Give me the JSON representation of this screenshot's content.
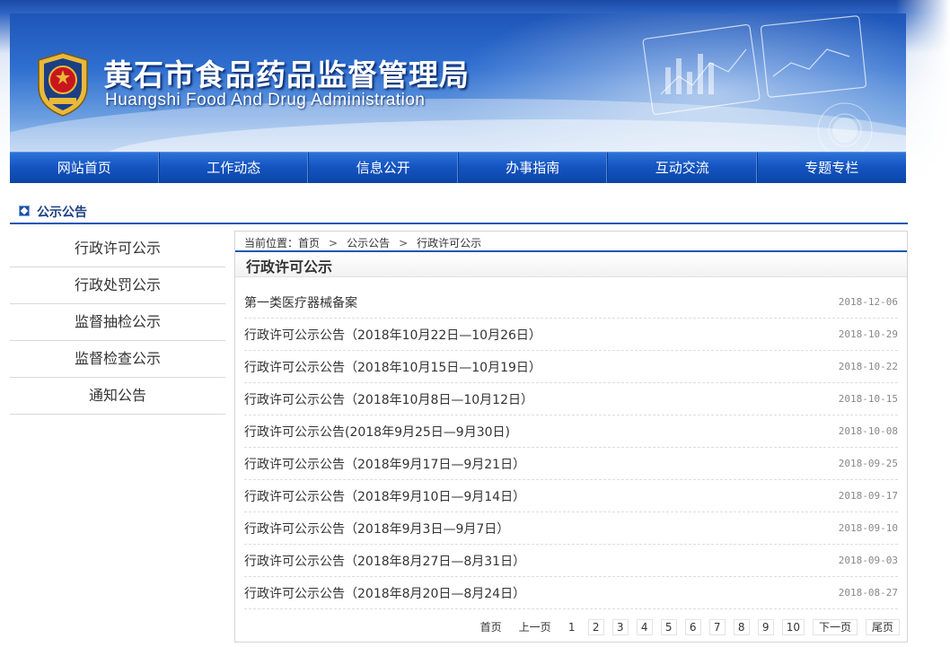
{
  "header": {
    "title": "黄石市食品药品监督管理局",
    "subtitle": "Huangshi Food And Drug Administration"
  },
  "nav": {
    "items": [
      "网站首页",
      "工作动态",
      "信息公开",
      "办事指南",
      "互动交流",
      "专题专栏"
    ]
  },
  "section": {
    "title": "公示公告"
  },
  "sidebar": {
    "items": [
      "行政许可公示",
      "行政处罚公示",
      "监督抽检公示",
      "监督检查公示",
      "通知公告"
    ]
  },
  "breadcrumb": {
    "prefix": "当前位置：",
    "home": "首页",
    "level1": "公示公告",
    "level2": "行政许可公示",
    "separator": ">"
  },
  "main": {
    "title": "行政许可公示",
    "articles": [
      {
        "title": "第一类医疗器械备案",
        "date": "2018-12-06"
      },
      {
        "title": "行政许可公示公告（2018年10月22日—10月26日）",
        "date": "2018-10-29"
      },
      {
        "title": "行政许可公示公告（2018年10月15日—10月19日）",
        "date": "2018-10-22"
      },
      {
        "title": "行政许可公示公告（2018年10月8日—10月12日）",
        "date": "2018-10-15"
      },
      {
        "title": "行政许可公示公告(2018年9月25日—9月30日)",
        "date": "2018-10-08"
      },
      {
        "title": "行政许可公示公告（2018年9月17日—9月21日）",
        "date": "2018-09-25"
      },
      {
        "title": "行政许可公示公告（2018年9月10日—9月14日）",
        "date": "2018-09-17"
      },
      {
        "title": "行政许可公示公告（2018年9月3日—9月7日）",
        "date": "2018-09-10"
      },
      {
        "title": "行政许可公示公告（2018年8月27日—8月31日）",
        "date": "2018-09-03"
      },
      {
        "title": "行政许可公示公告（2018年8月20日—8月24日）",
        "date": "2018-08-27"
      }
    ]
  },
  "pager": {
    "first": "首页",
    "prev": "上一页",
    "current": "1",
    "pages": [
      "2",
      "3",
      "4",
      "5",
      "6",
      "7",
      "8",
      "9",
      "10"
    ],
    "next": "下一页",
    "last": "尾页"
  },
  "colors": {
    "nav_blue": "#1555c1",
    "accent_blue": "#1c56b4",
    "emblem_red": "#c8161d",
    "emblem_gold": "#e9b93a"
  }
}
